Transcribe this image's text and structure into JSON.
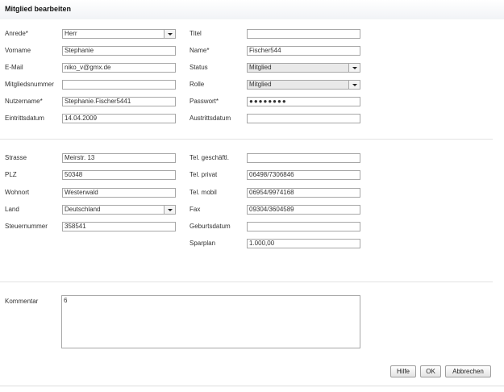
{
  "window": {
    "title": "Mitglied bearbeiten"
  },
  "labels": {
    "anrede": "Anrede*",
    "vorname": "Vorname",
    "email": "E-Mail",
    "mitgliedsnummer": "Mitgliedsnummer",
    "nutzername": "Nutzername*",
    "eintrittsdatum": "Eintrittsdatum",
    "titel": "Titel",
    "name": "Name*",
    "status": "Status",
    "rolle": "Rolle",
    "passwort": "Passwort*",
    "austrittsdatum": "Austrittsdatum",
    "strasse": "Strasse",
    "plz": "PLZ",
    "wohnort": "Wohnort",
    "land": "Land",
    "steuernummer": "Steuernummer",
    "tel_geschaeftl": "Tel. geschäftl.",
    "tel_privat": "Tel. privat",
    "tel_mobil": "Tel. mobil",
    "fax": "Fax",
    "geburtsdatum": "Geburtsdatum",
    "sparplan": "Sparplan",
    "kommentar": "Kommentar"
  },
  "values": {
    "anrede": "Herr",
    "vorname": "Stephanie",
    "email": "niko_v@gmx.de",
    "mitgliedsnummer": "",
    "nutzername": "Stephanie.Fischer5441",
    "eintrittsdatum": "14.04.2009",
    "titel": "",
    "name": "Fischer544",
    "status": "Mitglied",
    "rolle": "Mitglied",
    "passwort": "●●●●●●●●",
    "austrittsdatum": "",
    "strasse": "Meirstr. 13",
    "plz": "50348",
    "wohnort": "Westerwald",
    "land": "Deutschland",
    "steuernummer": "358541",
    "tel_geschaeftl": "",
    "tel_privat": "06498/7306846",
    "tel_mobil": "06954/9974168",
    "fax": "09304/3604589",
    "geburtsdatum": "",
    "sparplan": "1.000,00",
    "kommentar": "6"
  },
  "buttons": {
    "hilfe": "Hilfe",
    "ok": "OK",
    "abbrechen": "Abbrechen"
  },
  "icons": {
    "dropdown": "chevron-down-icon"
  },
  "colors": {
    "field_border": "#a7a7a7",
    "readonly_bg": "#e9e9e9",
    "separator": "#e2e2e2"
  }
}
